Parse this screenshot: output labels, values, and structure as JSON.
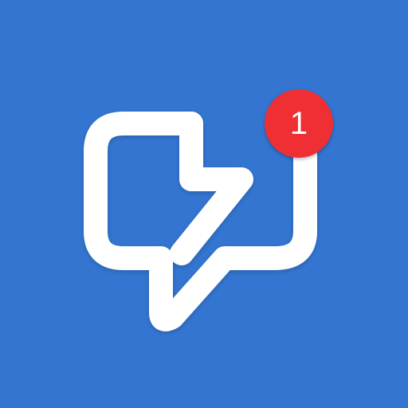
{
  "app_icon": {
    "icon": "message-bolt-icon",
    "badge": {
      "count": "1"
    },
    "colors": {
      "background": "#3375d0",
      "icon": "#ffffff",
      "badge": "#ef2f33",
      "badge_text": "#ffffff"
    }
  }
}
